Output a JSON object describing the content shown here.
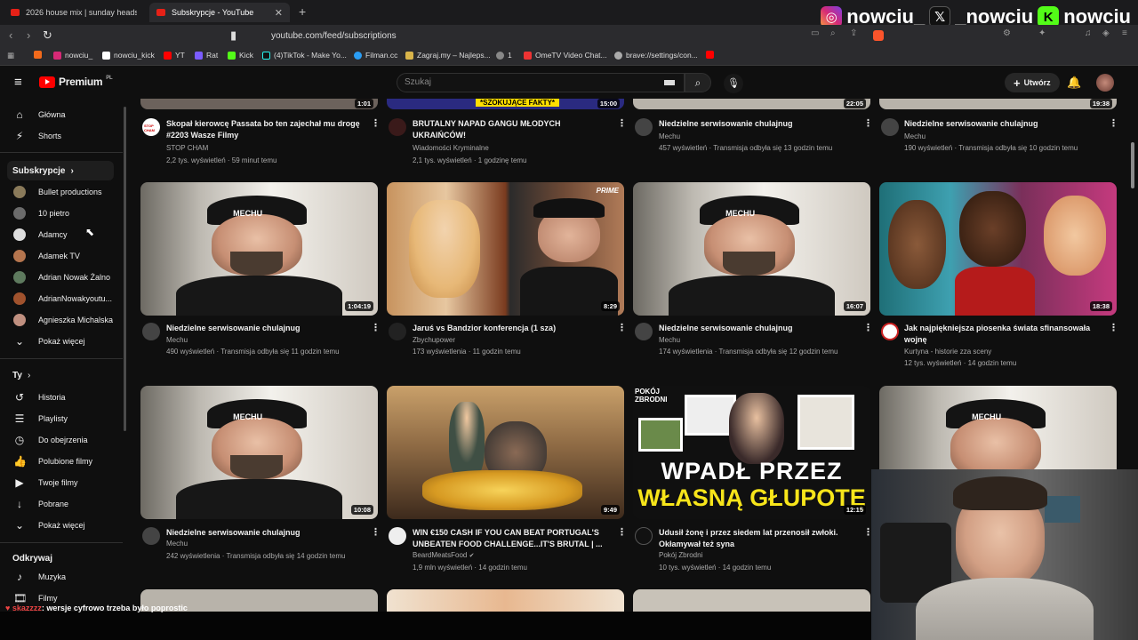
{
  "browser": {
    "tabs": [
      {
        "title": "2026 house mix | sunday headspace",
        "active": false
      },
      {
        "title": "Subskrypcje - YouTube",
        "active": true
      }
    ],
    "url": "youtube.com/feed/subscriptions",
    "bookmarks": [
      "nowciu_",
      "nowciu_kick",
      "YT",
      "Rat",
      "Kick",
      "(4)TikTok - Make Yo...",
      "Filman.cc",
      "Zagraj.my – Najleps...",
      "1",
      "OmeTV Video Chat...",
      "brave://settings/con..."
    ]
  },
  "overlay": {
    "social": [
      "nowciu_",
      "_nowciu",
      "nowciu"
    ],
    "chat_user": "skazzzz",
    "chat_message": ": wersje cyfrowo trzeba było poprostic"
  },
  "youtube": {
    "logo_text": "Premium",
    "logo_badge": "PL",
    "search_placeholder": "Szukaj",
    "create_label": "Utwórz"
  },
  "sidebar": {
    "main": [
      "Główna",
      "Shorts"
    ],
    "subscriptions_header": "Subskrypcje",
    "channels": [
      "Bullet productions",
      "10 pietro",
      "Adamcy",
      "Adamek TV",
      "Adrian Nowak Żalno",
      "AdrianNowakyoutu...",
      "Agnieszka Michalska"
    ],
    "show_more": "Pokaż więcej",
    "you_header": "Ty",
    "you_items": [
      "Historia",
      "Playlisty",
      "Do obejrzenia",
      "Polubione filmy",
      "Twoje filmy",
      "Pobrane",
      "Pokaż więcej"
    ],
    "explore_header": "Odkrywaj",
    "explore_items": [
      "Muzyka",
      "Filmy"
    ]
  },
  "videos": {
    "top_durations": [
      "1:01",
      "15:00",
      "22:05",
      "19:38"
    ],
    "top_banner": "*SZOKUJĄCE FAKTY*",
    "row0": [
      {
        "title": "Skopał kierowcę Passata bo ten zajechał mu drogę #2203 Wasze Filmy",
        "channel": "STOP CHAM",
        "meta": "2,2 tys. wyświetleń · 59 minut temu"
      },
      {
        "title": "BRUTALNY NAPAD GANGU MŁODYCH UKRAIŃCÓW!",
        "channel": "Wiadomości Kryminalne",
        "meta": "2,1 tys. wyświetleń · 1 godzinę temu"
      },
      {
        "title": "Niedzielne serwisowanie chulajnug",
        "channel": "Mechu",
        "meta": "457 wyświetleń · Transmisja odbyła się 13 godzin temu"
      },
      {
        "title": "Niedzielne serwisowanie chulajnug",
        "channel": "Mechu",
        "meta": "190 wyświetleń · Transmisja odbyła się 10 godzin temu"
      }
    ],
    "row1": [
      {
        "title": "Niedzielne serwisowanie chulajnug",
        "channel": "Mechu",
        "meta": "490 wyświetleń · Transmisja odbyła się 11 godzin temu",
        "duration": "1:04:19"
      },
      {
        "title": "Jaruś vs Bandzior konferencja (1 sza)",
        "channel": "Zbychupower",
        "meta": "173 wyświetlenia · 11 godzin temu",
        "duration": "8:29"
      },
      {
        "title": "Niedzielne serwisowanie chulajnug",
        "channel": "Mechu",
        "meta": "174 wyświetlenia · Transmisja odbyła się 12 godzin temu",
        "duration": "16:07"
      },
      {
        "title": "Jak najpiękniejsza piosenka świata sfinansowała wojnę",
        "channel": "Kurtyna - historie zza sceny",
        "meta": "12 tys. wyświetleń · 14 godzin temu",
        "duration": "18:38"
      }
    ],
    "row2": [
      {
        "title": "Niedzielne serwisowanie chulajnug",
        "channel": "Mechu",
        "meta": "242 wyświetlenia · Transmisja odbyła się 14 godzin temu",
        "duration": "10:08"
      },
      {
        "title": "WIN €150 CASH IF YOU CAN BEAT PORTUGAL'S UNBEATEN FOOD CHALLENGE...IT'S BRUTAL | ...",
        "channel": "BeardMeatsFood",
        "meta": "1,9 mln wyświetleń · 14 godzin temu",
        "duration": "9:49"
      },
      {
        "title": "Udusił żonę i przez siedem lat przenosił zwłoki. Okłamywał też syna",
        "channel": "Pokój Zbrodni",
        "meta": "10 tys. wyświetleń · 14 godzin temu",
        "duration": "12:15"
      }
    ],
    "thumb_text": {
      "mechu": "MECHU",
      "prime": "PRIME",
      "pokoj": "POKÓJ ZBRODNI",
      "wpadl1": "WPADŁ PRZEZ",
      "wpadl2": "WŁASNĄ GŁUPOTĘ",
      "stopcham": "STOP CHAM"
    }
  }
}
